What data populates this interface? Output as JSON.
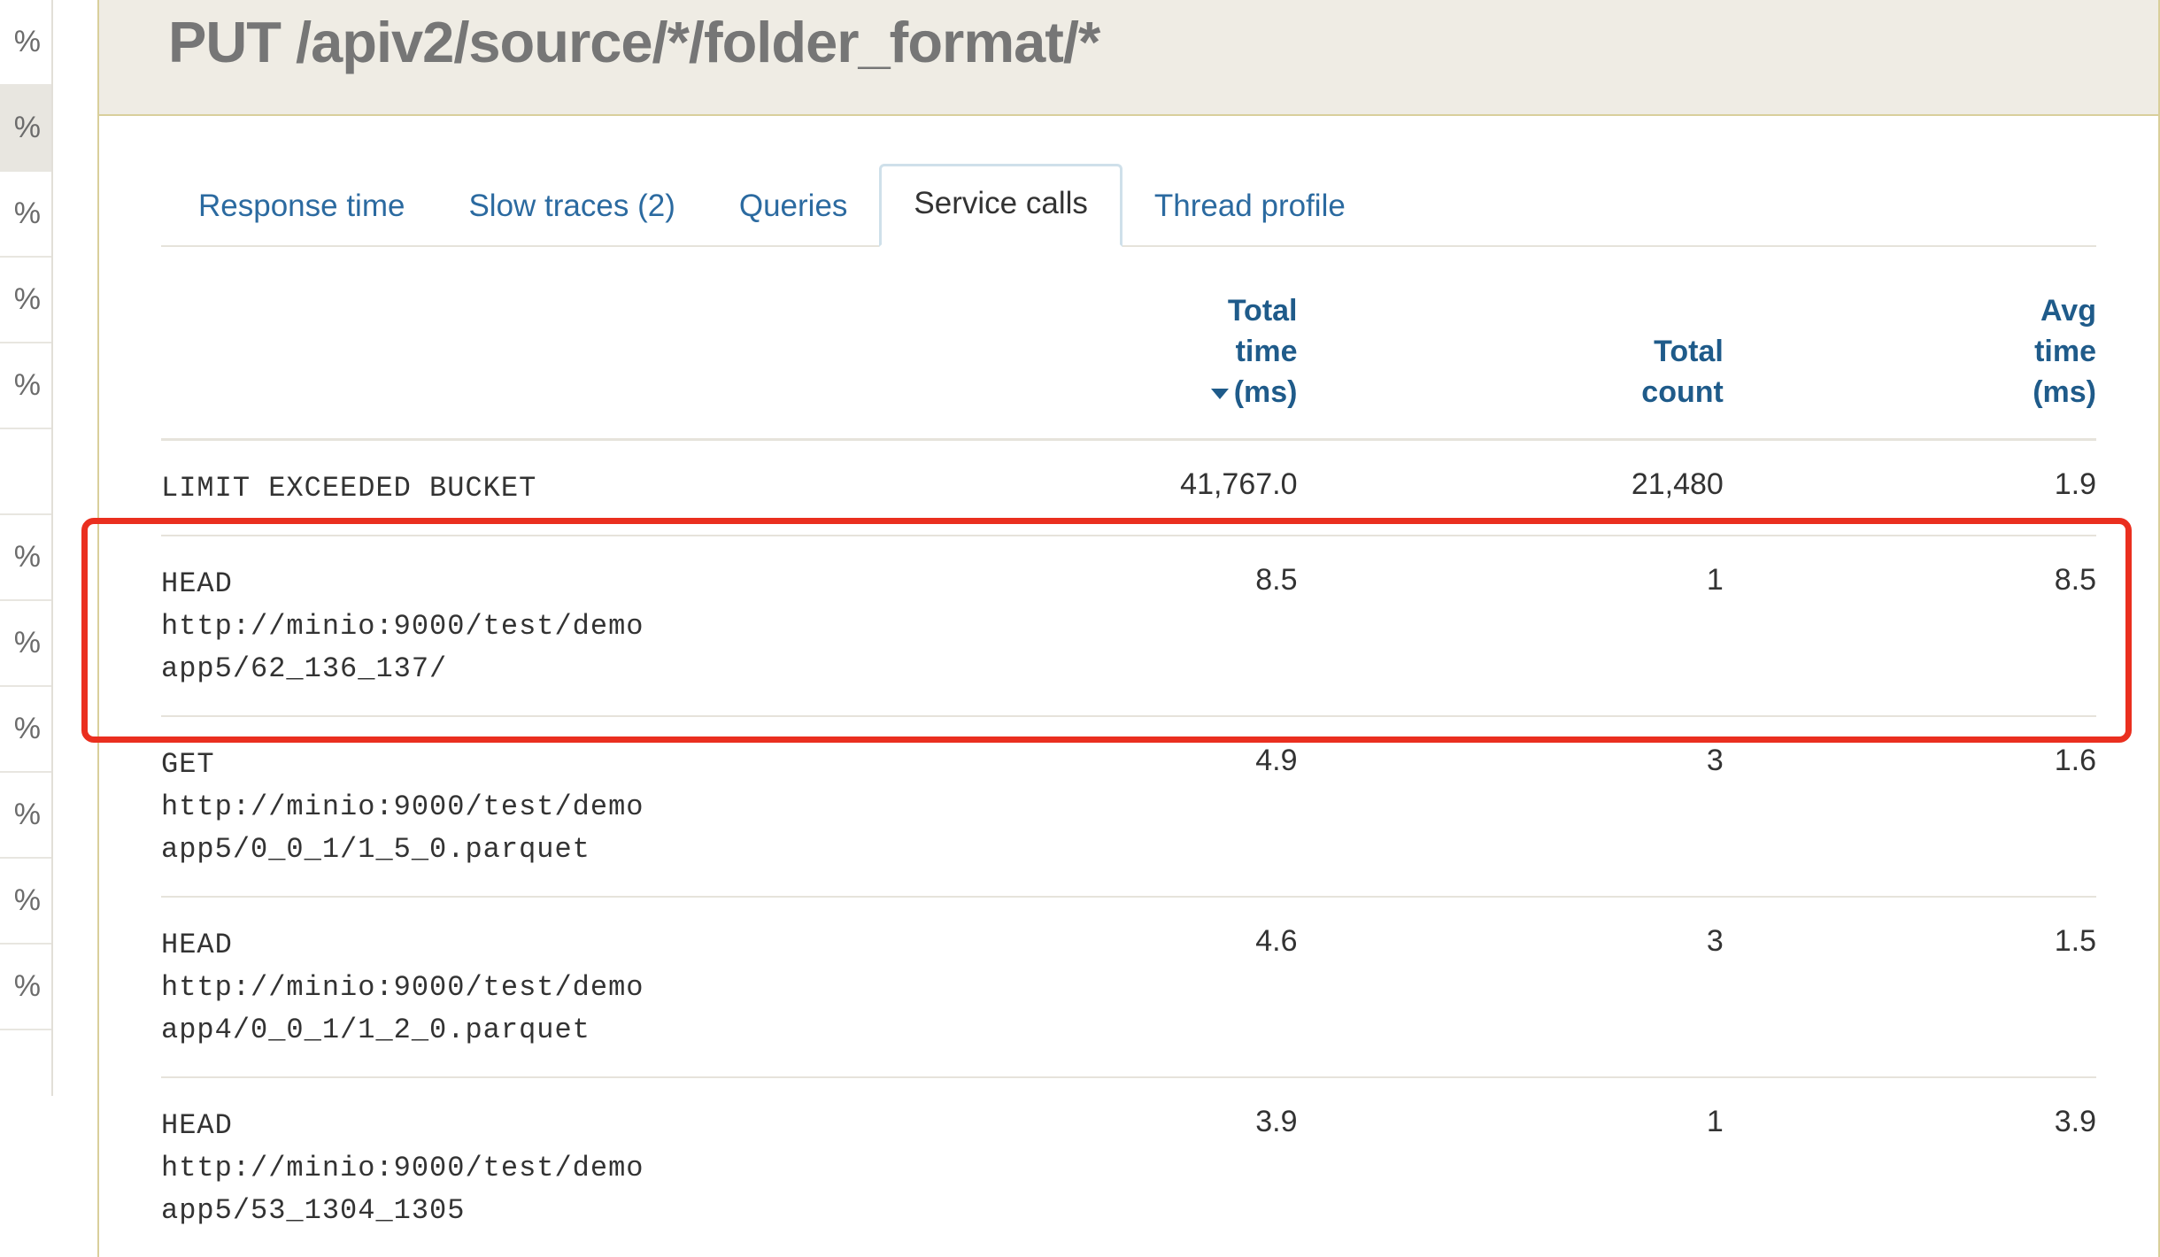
{
  "sidebar": {
    "items": [
      {
        "label": "%",
        "selected": false
      },
      {
        "label": "%",
        "selected": true
      },
      {
        "label": "%",
        "selected": false
      },
      {
        "label": "%",
        "selected": false
      },
      {
        "label": "%",
        "selected": false
      },
      {
        "label": "",
        "selected": false,
        "spacer": true
      },
      {
        "label": "%",
        "selected": false
      },
      {
        "label": "%",
        "selected": false
      },
      {
        "label": "%",
        "selected": false
      },
      {
        "label": "%",
        "selected": false
      },
      {
        "label": "%",
        "selected": false
      },
      {
        "label": "%",
        "selected": false
      }
    ]
  },
  "header": {
    "title": "PUT /apiv2/source/*/folder_format/*"
  },
  "tabs": [
    {
      "label": "Response time",
      "active": false
    },
    {
      "label": "Slow traces (2)",
      "active": false
    },
    {
      "label": "Queries",
      "active": false
    },
    {
      "label": "Service calls",
      "active": true
    },
    {
      "label": "Thread profile",
      "active": false
    }
  ],
  "table": {
    "columns": {
      "name": "",
      "total_time_line1": "Total",
      "total_time_line2": "time",
      "total_time_line3": "(ms)",
      "total_count_line1": "Total",
      "total_count_line2": "count",
      "avg_time_line1": "Avg",
      "avg_time_line2": "time",
      "avg_time_line3": "(ms)"
    },
    "sorted_by": "total_time_desc",
    "rows": [
      {
        "name": "LIMIT EXCEEDED BUCKET",
        "total_time": "41,767.0",
        "total_count": "21,480",
        "avg_time": "1.9",
        "highlighted": false
      },
      {
        "name": "HEAD\nhttp://minio:9000/test/demo\napp5/62_136_137/",
        "total_time": "8.5",
        "total_count": "1",
        "avg_time": "8.5",
        "highlighted": true
      },
      {
        "name": "GET\nhttp://minio:9000/test/demo\napp5/0_0_1/1_5_0.parquet",
        "total_time": "4.9",
        "total_count": "3",
        "avg_time": "1.6",
        "highlighted": false
      },
      {
        "name": "HEAD\nhttp://minio:9000/test/demo\napp4/0_0_1/1_2_0.parquet",
        "total_time": "4.6",
        "total_count": "3",
        "avg_time": "1.5",
        "highlighted": false
      },
      {
        "name": "HEAD\nhttp://minio:9000/test/demo\napp5/53_1304_1305",
        "total_time": "3.9",
        "total_count": "1",
        "avg_time": "3.9",
        "highlighted": false
      }
    ]
  }
}
